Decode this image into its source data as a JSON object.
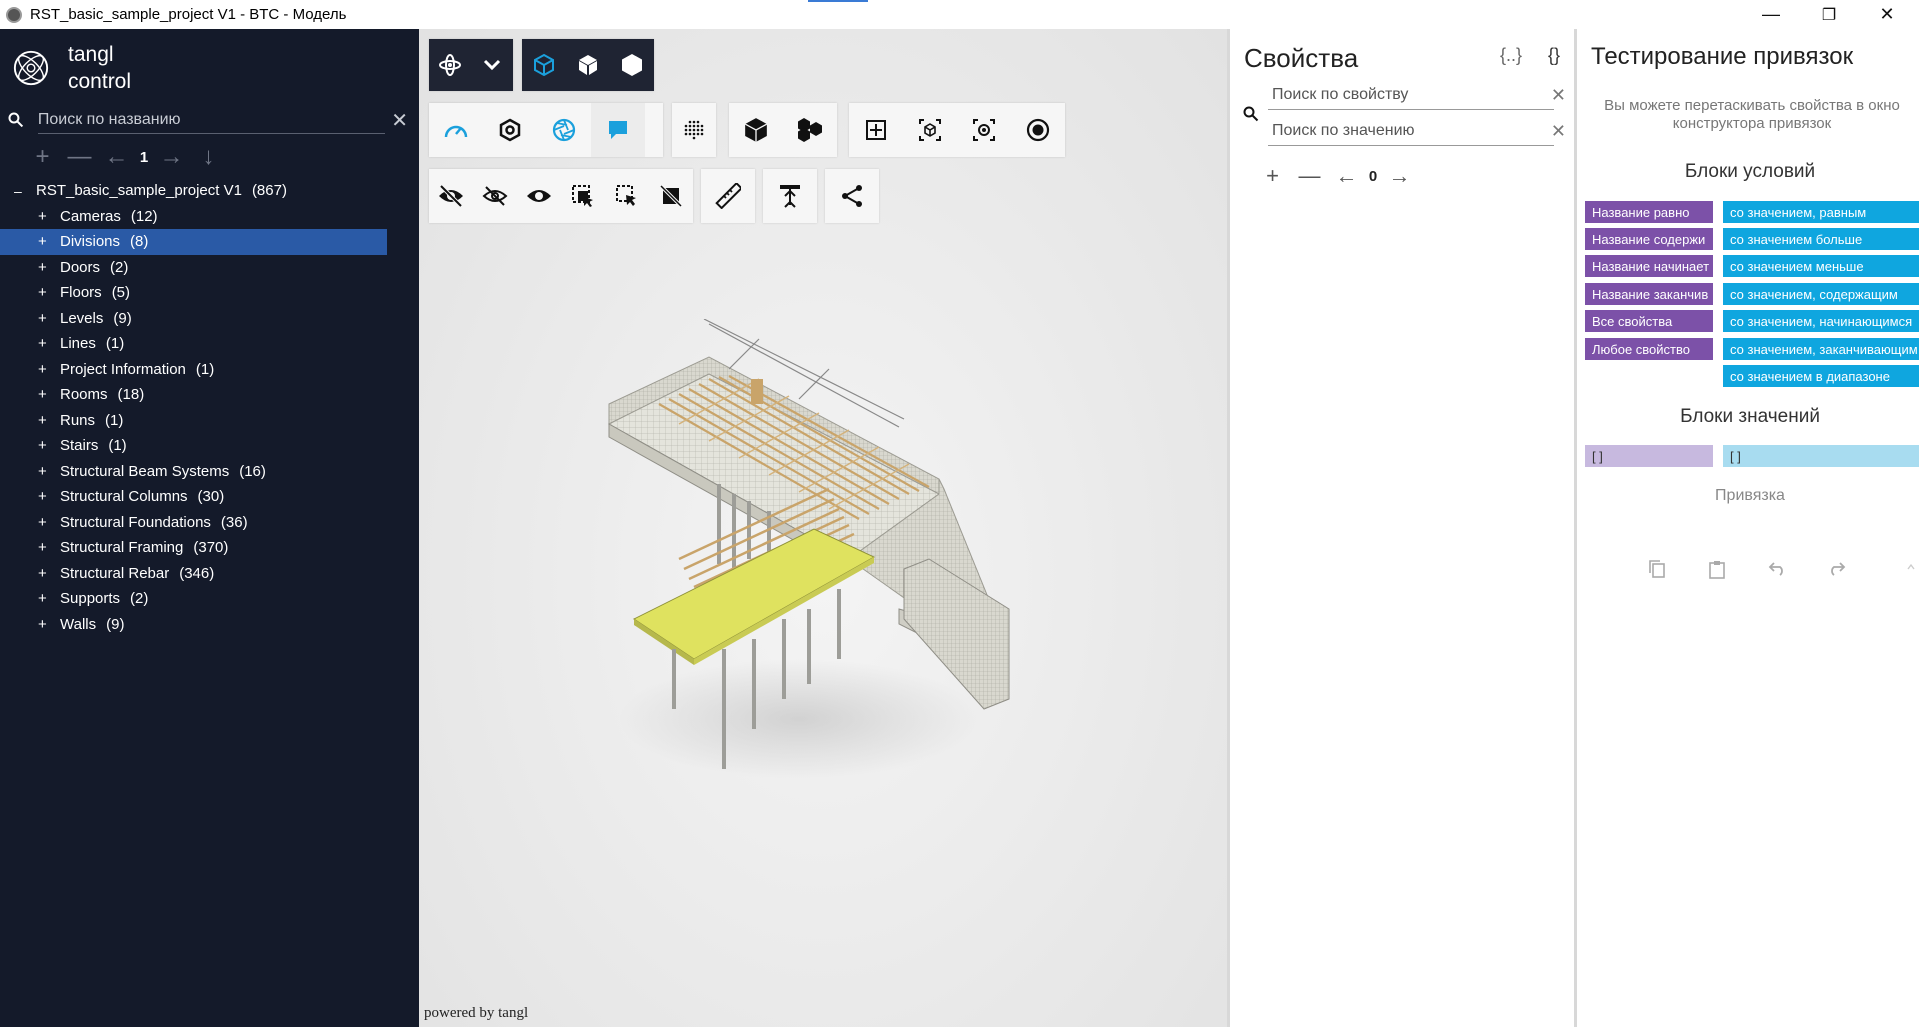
{
  "window": {
    "title": "RST_basic_sample_project V1 - BTC - Модель",
    "minimize": "—",
    "maximize": "❐",
    "close": "✕"
  },
  "sidebar": {
    "logo_line1": "tangl",
    "logo_line2": "control",
    "search_placeholder": "Поиск по названию",
    "search_clear": "✕",
    "tools": {
      "add": "+",
      "remove": "—",
      "prev": "←",
      "page": "1",
      "next": "→",
      "down": "↓"
    },
    "root": {
      "toggle": "–",
      "label": "RST_basic_sample_project V1",
      "count": "(867)"
    },
    "items": [
      {
        "label": "Cameras",
        "count": "(12)"
      },
      {
        "label": "Divisions",
        "count": "(8)"
      },
      {
        "label": "Doors",
        "count": "(2)"
      },
      {
        "label": "Floors",
        "count": "(5)"
      },
      {
        "label": "Levels",
        "count": "(9)"
      },
      {
        "label": "Lines",
        "count": "(1)"
      },
      {
        "label": "Project Information",
        "count": "(1)"
      },
      {
        "label": "Rooms",
        "count": "(18)"
      },
      {
        "label": "Runs",
        "count": "(1)"
      },
      {
        "label": "Stairs",
        "count": "(1)"
      },
      {
        "label": "Structural Beam Systems",
        "count": "(16)"
      },
      {
        "label": "Structural Columns",
        "count": "(30)"
      },
      {
        "label": "Structural Foundations",
        "count": "(36)"
      },
      {
        "label": "Structural Framing",
        "count": "(370)"
      },
      {
        "label": "Structural Rebar",
        "count": "(346)"
      },
      {
        "label": "Supports",
        "count": "(2)"
      },
      {
        "label": "Walls",
        "count": "(9)"
      }
    ],
    "toggle_plus": "+"
  },
  "viewer": {
    "powered_by": "powered by tangl",
    "accent_color": "#1ba0dc"
  },
  "properties": {
    "title": "Свойства",
    "icon_a": "{..}",
    "icon_b": "{}",
    "search_property_placeholder": "Поиск по свойству",
    "search_value_placeholder": "Поиск по значению",
    "clear": "✕",
    "tools": {
      "add": "+",
      "remove": "—",
      "prev": "←",
      "page": "0",
      "next": "→"
    }
  },
  "binding": {
    "title": "Тестирование привязок",
    "hint": "Вы можете перетаскивать свойства в окно конструктора привязок",
    "conditions_heading": "Блоки условий",
    "name_blocks": [
      "Название  равно",
      "Название  содержи",
      "Название  начинает",
      "Название  заканчив",
      "Все свойства",
      "Любое свойство"
    ],
    "value_blocks": [
      "со значением, равным",
      "со значением больше",
      "со значением меньше",
      "со значением, содержащим",
      "со значением, начинающимся",
      "со значением, заканчивающим",
      "со значением в диапазоне"
    ],
    "values_heading": "Блоки значений",
    "value_placeholder_left": "[ ]",
    "value_placeholder_right": "[ ]",
    "binding_label": "Привязка"
  }
}
